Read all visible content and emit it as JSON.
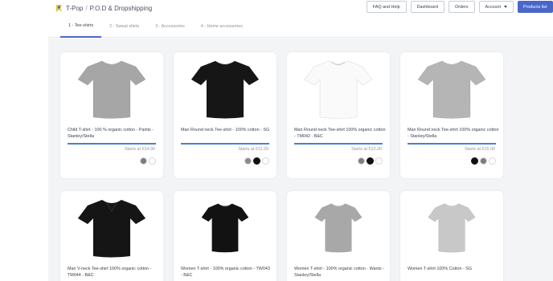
{
  "app": {
    "name": "T-Pop",
    "section": "P.O.D & Dropshipping"
  },
  "top_actions": {
    "faq": "FAQ and Help",
    "dashboard": "Dashboard",
    "orders": "Orders",
    "account": "Account",
    "products": "Products list"
  },
  "tabs": [
    "1 - Tee-shirts",
    "2 - Sweat shirts",
    "3 - Accessories",
    "4 - Home accessories"
  ],
  "active_tab": 0,
  "colors": {
    "accent": "#4b66c9",
    "underline": "#4b7fd4",
    "grey_shirt": "#a9a9a9",
    "black_shirt": "#151515",
    "white_shirt": "#fbfbfb",
    "light_grey_shirt": "#c9c9c9"
  },
  "products": [
    {
      "title": "Child T-shirt - 100 % organic cotton - Paints - Stanley/Stella",
      "price": "Starts at €14.90",
      "swatches": [
        "#7d7d7d",
        "#ffffff"
      ],
      "shirt_color": "#a6a6a6",
      "icon": "tshirt-grey"
    },
    {
      "title": "Man Round neck Tee-shirt - 100% cotton - SG",
      "price": "Starts at €11.20",
      "swatches": [
        "#8a8a8a",
        "#111111",
        "#ffffff"
      ],
      "shirt_color": "#161616",
      "icon": "tshirt-black"
    },
    {
      "title": "Man Round neck Tee-shirt 100% organic cotton - TM042 - B&C",
      "price": "Starts at €12.20",
      "swatches": [
        "#7d7d7d",
        "#111111",
        "#ffffff"
      ],
      "shirt_color": "#fafafa",
      "icon": "tshirt-white"
    },
    {
      "title": "Man Round neck Tee-shirt 100% organic cotton - Stanley/Stella",
      "price": "Starts at €15.00",
      "swatches": [
        "#111111",
        "#7d7d7d",
        "#ffffff"
      ],
      "shirt_color": "#b5b5b5",
      "icon": "tshirt-light-grey"
    },
    {
      "title": "Man V-neck Tee-shirt 100% organic cotton - TM044 - B&C",
      "price": "",
      "swatches": [],
      "shirt_color": "#151515",
      "icon": "tshirt-black-vneck"
    },
    {
      "title": "Women T-shirt - 100% organic cotton - TW043 - B&C",
      "price": "",
      "swatches": [],
      "shirt_color": "#121212",
      "icon": "tshirt-black-women"
    },
    {
      "title": "Women T-shirt - 100% organic cotton - Wants - Stanley/Stella",
      "price": "",
      "swatches": [],
      "shirt_color": "#a8a8a8",
      "icon": "tshirt-grey-women"
    },
    {
      "title": "Women T-shirt 100% Cotton - SG",
      "price": "",
      "swatches": [],
      "shirt_color": "#c8c8c8",
      "icon": "tshirt-light-grey-women"
    }
  ]
}
